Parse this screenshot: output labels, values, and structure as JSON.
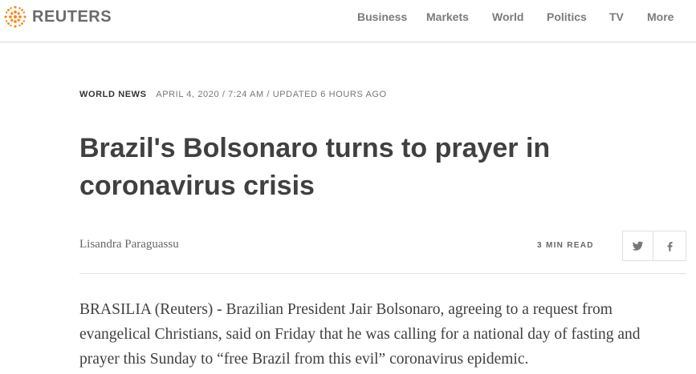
{
  "brand": {
    "name": "REUTERS",
    "accent": "#ff8000"
  },
  "nav": {
    "items": [
      {
        "label": "Business"
      },
      {
        "label": "Markets"
      },
      {
        "label": "World"
      },
      {
        "label": "Politics"
      },
      {
        "label": "TV"
      },
      {
        "label": "More"
      }
    ]
  },
  "article": {
    "section": "WORLD NEWS",
    "dateline": "APRIL 4, 2020 / 7:24 AM / UPDATED 6 HOURS AGO",
    "headline": "Brazil's Bolsonaro turns to prayer in coronavirus crisis",
    "author": "Lisandra Paraguassu",
    "read_time": "3 MIN READ",
    "share_icons": [
      "twitter-icon",
      "facebook-icon"
    ],
    "body": "BRASILIA (Reuters) - Brazilian President Jair Bolsonaro, agreeing to a request from evangelical Christians, said on Friday that he was calling for a national day of fasting and prayer this Sunday to “free Brazil from this evil” coronavirus epidemic."
  }
}
